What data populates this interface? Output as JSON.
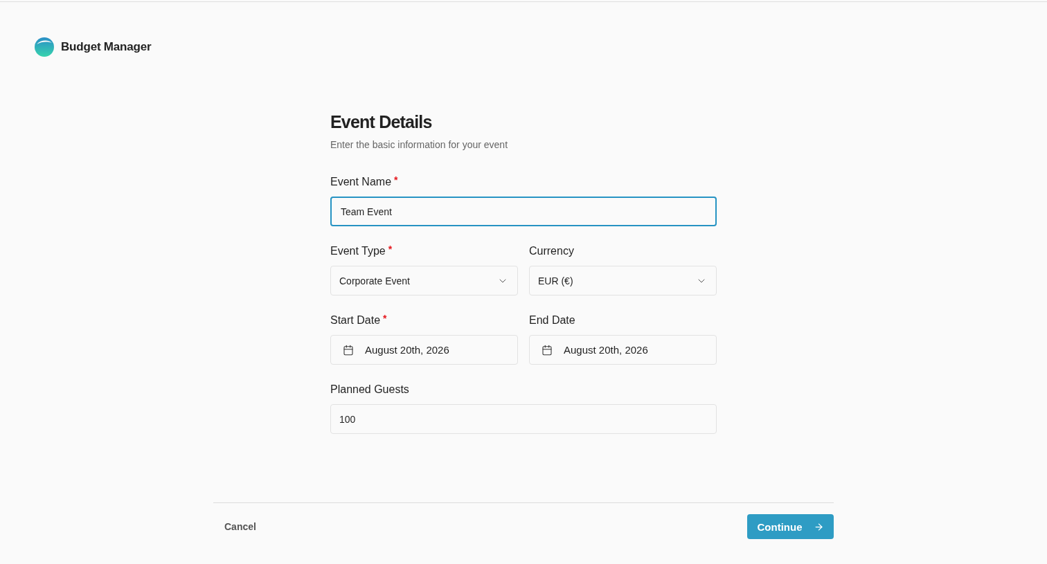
{
  "app": {
    "name": "Budget Manager"
  },
  "form": {
    "title": "Event Details",
    "subtitle": "Enter the basic information for your event",
    "required_mark": "*",
    "rows": [
      {
        "fields": [
          {
            "kind": "text",
            "label": "Event Name",
            "required": true,
            "focused": true,
            "value": "Team Event"
          }
        ]
      },
      {
        "fields": [
          {
            "kind": "select",
            "label": "Event Type",
            "required": true,
            "focused": false,
            "value": "Corporate Event"
          },
          {
            "kind": "select",
            "label": "Currency",
            "required": false,
            "focused": false,
            "value": "EUR (€)"
          }
        ]
      },
      {
        "fields": [
          {
            "kind": "date",
            "label": "Start Date",
            "required": true,
            "focused": false,
            "value": "August 20th, 2026"
          },
          {
            "kind": "date",
            "label": "End Date",
            "required": false,
            "focused": false,
            "value": "August 20th, 2026"
          }
        ]
      },
      {
        "fields": [
          {
            "kind": "text",
            "label": "Planned Guests",
            "required": false,
            "focused": false,
            "value": "100"
          }
        ]
      }
    ]
  },
  "footer": {
    "cancel": "Cancel",
    "continue": "Continue"
  }
}
